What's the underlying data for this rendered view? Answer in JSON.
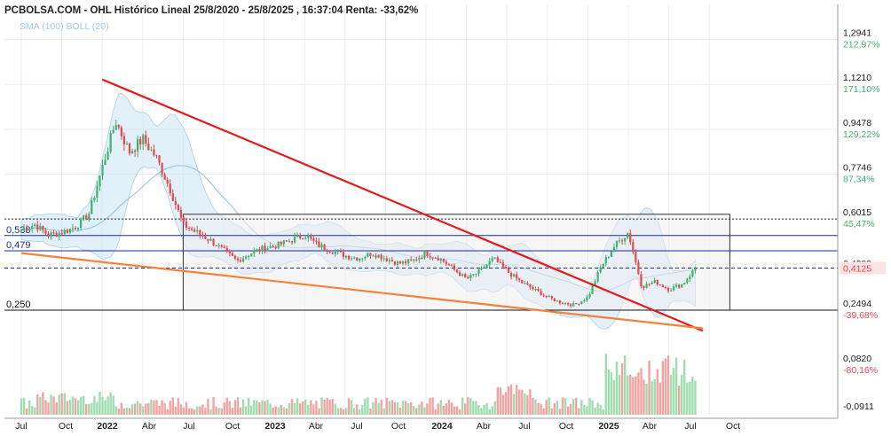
{
  "header": {
    "title": "PCBOLSA.COM - OHL Histórico Lineal 25/8/2020 - 25/8/2025 , 16:37:04 Renta: -33,62%",
    "legend": "SMA (100) BOLL (20)"
  },
  "colors": {
    "up": "#3fb36a",
    "down": "#e5484d",
    "volume_up": "#9fdcb0",
    "volume_down": "#f2a3a3",
    "band_fill": "#cfe6f6",
    "sma": "#8fc2e3",
    "resistance_trend": "#e41a1c",
    "support_trend": "#f7803a",
    "hline": "#1a2b9c",
    "box_fill": "#eeeeee"
  },
  "chart_data": [
    {
      "type": "line",
      "title": "PCBOLSA.COM - OHL Histórico Lineal 25/8/2020 - 25/8/2025 , 16:37:04 Renta: -33,62%",
      "series_kind": "candlestick",
      "x_tick_labels": [
        "Jul",
        "Oct",
        "2022",
        "Abr",
        "Jul",
        "Oct",
        "2023",
        "Abr",
        "Jul",
        "Oct",
        "2024",
        "Abr",
        "Jul",
        "Oct",
        "2025",
        "Abr",
        "Jul",
        "Oct"
      ],
      "x_range": [
        "2021-06",
        "2025-10"
      ],
      "y_range": [
        0.2,
        1.32
      ],
      "y_ticks": [
        {
          "value": 1.2941,
          "label": "1,2941",
          "pct": "212,97%"
        },
        {
          "value": 1.121,
          "label": "1,1210",
          "pct": "171,10%"
        },
        {
          "value": 0.9478,
          "label": "0,9478",
          "pct": "129,22%"
        },
        {
          "value": 0.7746,
          "label": "0,7746",
          "pct": "87,34%"
        },
        {
          "value": 0.6015,
          "label": "0,6015",
          "pct": "45,47%"
        },
        {
          "value": 0.4283,
          "label": "0,4283",
          "pct": ""
        },
        {
          "value": 0.2494,
          "label": "0,2494",
          "pct": "-39,68%"
        }
      ],
      "last_price": {
        "value": 0.4125,
        "label": "0,4125"
      },
      "horizontal_levels": [
        {
          "value": 0.538,
          "label": "0,538"
        },
        {
          "value": 0.479,
          "label": "0,479"
        },
        {
          "value": 0.25,
          "label": "0,250"
        }
      ],
      "dotted_level": 0.6015,
      "resistance_trendline": [
        [
          "2021-12",
          1.14
        ],
        [
          "2025-08",
          0.17
        ]
      ],
      "support_trendline": [
        [
          "2021-06",
          0.47
        ],
        [
          "2025-08",
          0.18
        ]
      ],
      "range_box": {
        "from": "2022-06",
        "to": "2025-10",
        "high": 0.62,
        "low": 0.25
      },
      "price_path": [
        [
          "2021-06",
          0.56
        ],
        [
          "2021-07",
          0.58
        ],
        [
          "2021-08",
          0.54
        ],
        [
          "2021-09",
          0.55
        ],
        [
          "2021-10",
          0.57
        ],
        [
          "2021-11",
          0.62
        ],
        [
          "2021-12",
          0.8
        ],
        [
          "2022-01",
          0.98
        ],
        [
          "2022-02",
          0.86
        ],
        [
          "2022-03",
          0.91
        ],
        [
          "2022-04",
          0.84
        ],
        [
          "2022-05",
          0.72
        ],
        [
          "2022-06",
          0.58
        ],
        [
          "2022-07",
          0.55
        ],
        [
          "2022-08",
          0.52
        ],
        [
          "2022-09",
          0.48
        ],
        [
          "2022-10",
          0.44
        ],
        [
          "2022-11",
          0.47
        ],
        [
          "2022-12",
          0.49
        ],
        [
          "2023-01",
          0.5
        ],
        [
          "2023-02",
          0.52
        ],
        [
          "2023-03",
          0.54
        ],
        [
          "2023-04",
          0.5
        ],
        [
          "2023-05",
          0.48
        ],
        [
          "2023-06",
          0.46
        ],
        [
          "2023-07",
          0.45
        ],
        [
          "2023-08",
          0.47
        ],
        [
          "2023-09",
          0.45
        ],
        [
          "2023-10",
          0.43
        ],
        [
          "2023-11",
          0.44
        ],
        [
          "2023-12",
          0.47
        ],
        [
          "2024-01",
          0.45
        ],
        [
          "2024-02",
          0.41
        ],
        [
          "2024-03",
          0.37
        ],
        [
          "2024-04",
          0.4
        ],
        [
          "2024-05",
          0.45
        ],
        [
          "2024-06",
          0.4
        ],
        [
          "2024-07",
          0.36
        ],
        [
          "2024-08",
          0.33
        ],
        [
          "2024-09",
          0.3
        ],
        [
          "2024-10",
          0.28
        ],
        [
          "2024-11",
          0.27
        ],
        [
          "2024-12",
          0.3
        ],
        [
          "2025-01",
          0.42
        ],
        [
          "2025-02",
          0.5
        ],
        [
          "2025-03",
          0.55
        ],
        [
          "2025-04",
          0.34
        ],
        [
          "2025-05",
          0.36
        ],
        [
          "2025-06",
          0.33
        ],
        [
          "2025-07",
          0.35
        ],
        [
          "2025-08",
          0.4125
        ]
      ],
      "volume_y_ticks": [
        {
          "value": 0.082,
          "label": "0,0820",
          "pct": "-80,16%"
        },
        {
          "value": -0.0911,
          "label": "-0,0911",
          "pct": ""
        }
      ]
    }
  ]
}
